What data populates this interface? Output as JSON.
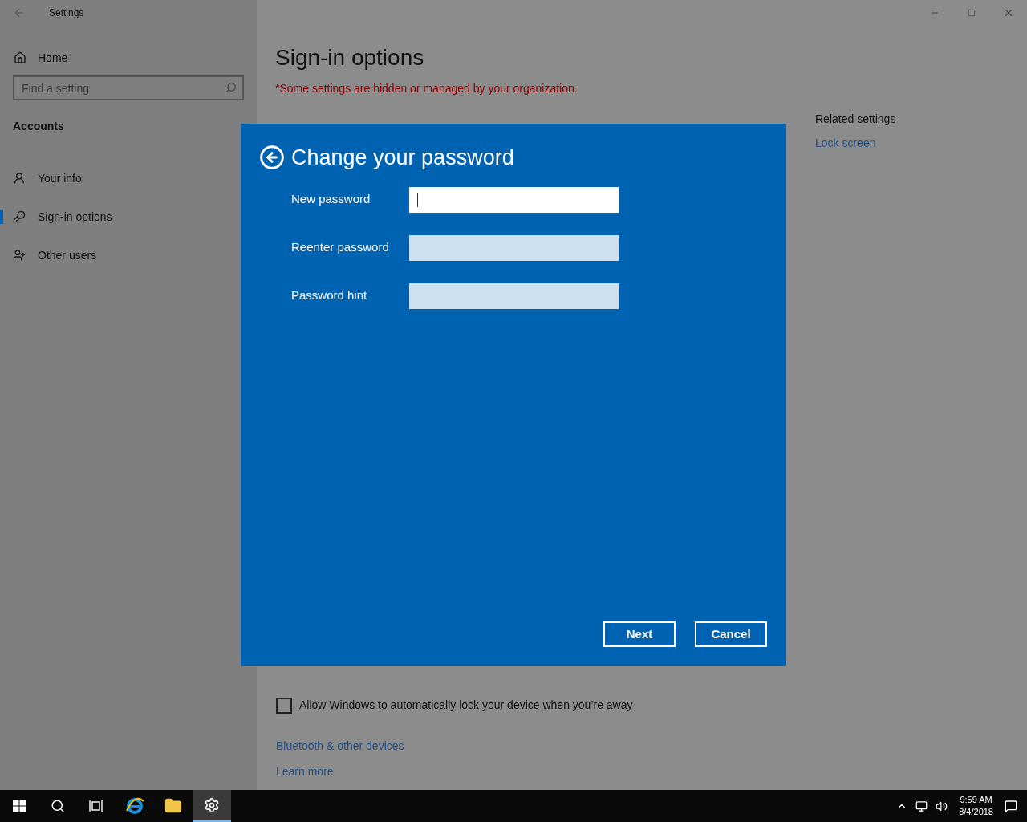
{
  "window": {
    "title": "Settings"
  },
  "sidebar": {
    "home": "Home",
    "search": {
      "placeholder": "Find a setting"
    },
    "section": "Accounts",
    "items": [
      {
        "label": "Your info",
        "kind": "info",
        "selected": false
      },
      {
        "label": "Sign-in options",
        "kind": "key",
        "selected": true
      },
      {
        "label": "Other users",
        "kind": "users",
        "selected": false
      }
    ]
  },
  "main": {
    "title": "Sign-in options",
    "notice": "*Some settings are hidden or managed by your organization.",
    "checkbox": {
      "label": "Allow Windows to automatically lock your device when you’re away",
      "checked": false
    },
    "links": [
      "Bluetooth & other devices",
      "Learn more"
    ],
    "related": {
      "heading": "Related settings",
      "links": [
        "Lock screen"
      ]
    }
  },
  "dialog": {
    "title": "Change your password",
    "fields": [
      {
        "label": "New password",
        "focused": true
      },
      {
        "label": "Reenter password",
        "focused": false
      },
      {
        "label": "Password hint",
        "focused": false
      }
    ],
    "buttons": [
      "Next",
      "Cancel"
    ]
  },
  "taskbar": {
    "items": [
      {
        "kind": "start",
        "selected": false
      },
      {
        "kind": "search",
        "selected": false
      },
      {
        "kind": "taskview",
        "selected": false
      },
      {
        "kind": "browser",
        "selected": false
      },
      {
        "kind": "folder",
        "selected": false
      },
      {
        "kind": "settings",
        "selected": true
      }
    ],
    "time": "9:59 AM",
    "date": "8/4/2018"
  }
}
